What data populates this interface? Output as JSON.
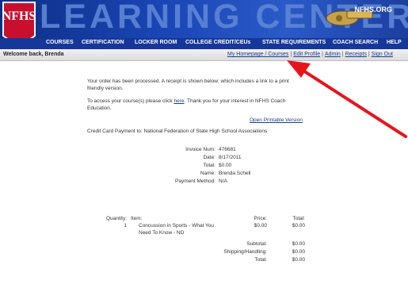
{
  "brand": {
    "logo_text": "NFHS",
    "title": "LEARNING CENTER",
    "site": "NFHS.ORG"
  },
  "nav": [
    "COURSES",
    "CERTIFICATION",
    "LOCKER ROOM",
    "COLLEGE CREDIT/CEUs",
    "STATE REQUIREMENTS",
    "COACH SEARCH",
    "HELP"
  ],
  "welcome": "Welcome back, Brenda",
  "toplinks": [
    "My Homepage / Courses",
    "Edit Profile",
    "Admin",
    "Receipts",
    "Sign Out"
  ],
  "body": {
    "line1a": "Your order has been processed. A receipt is shown below; which includes a link to a print",
    "line1b": "friendly version.",
    "line2a": "To access your course(s) please click",
    "here": "here",
    "line2b": ". Thank you for your interest in NFHS Coach",
    "line2c": "Education.",
    "printable": "Open Printable Version",
    "payment_to": "Credit Card Payment to: National Federation of State High School Associations"
  },
  "invoice": {
    "labels": [
      "Invoice Num:",
      "Date:",
      "Total:",
      "Name:",
      "Payment Method:"
    ],
    "values": [
      "476681",
      "8/17/2011",
      "$0.00",
      "Brenda Schell",
      "N/A"
    ]
  },
  "items": {
    "headers": {
      "qty": "Quantity:",
      "item": "Item:",
      "price": "Price:",
      "total": "Total:"
    },
    "rows": [
      {
        "qty": "1",
        "item1": "Concussion in Sports - What You",
        "item2": "Need To Know - ND",
        "price": "$0.00",
        "total": "$0.00"
      }
    ],
    "summary": [
      {
        "label": "Subtotal:",
        "value": "$0.00"
      },
      {
        "label": "Shipping/Handling:",
        "value": "$0.00"
      },
      {
        "label": "Total:",
        "value": "$0.00"
      }
    ]
  },
  "colors": {
    "banner": "#1a46b5",
    "nav": "#16379a",
    "logo_red": "#c8102e",
    "arrow": "#e8141c",
    "link": "#1d3c8c"
  }
}
